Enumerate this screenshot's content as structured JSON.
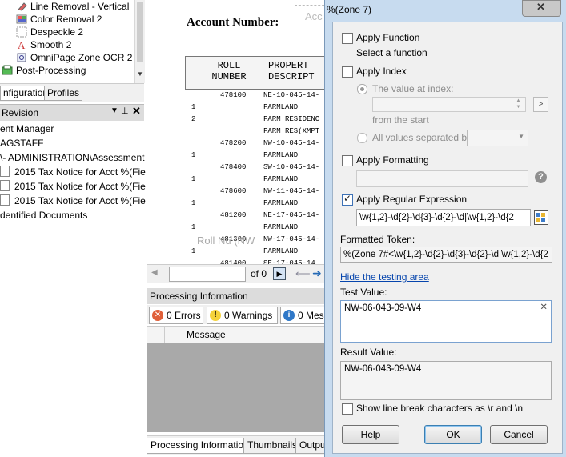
{
  "left_tree": {
    "items": [
      {
        "label": "Line Removal - Vertical",
        "icon": "eraser-icon"
      },
      {
        "label": "Color Removal 2",
        "icon": "color-palette-icon"
      },
      {
        "label": "Despeckle 2",
        "icon": "despeckle-icon"
      },
      {
        "label": "Smooth 2",
        "icon": "smooth-a-icon"
      },
      {
        "label": "OmniPage Zone OCR 2",
        "icon": "ocr-icon"
      },
      {
        "label": "Post-Processing",
        "icon": "post-processing-icon"
      }
    ],
    "tabs": {
      "configuration": "nfiguration",
      "profiles": "Profiles"
    }
  },
  "revision_panel": {
    "title": "Revision",
    "lines": [
      "ent Manager",
      "AGSTAFF",
      "\\- ADMINISTRATION\\Assessment",
      "2015 Tax Notice for Acct %(Fie",
      "2015 Tax Notice for Acct %(Fie",
      "2015 Tax Notice for Acct %(Fie",
      "dentified Documents"
    ]
  },
  "document": {
    "account_label": "Account Number:",
    "account_placeholder": "Acc",
    "col_roll": "ROLL NUMBER",
    "col_prop": "PROPERT DESCRIPT",
    "rows": [
      {
        "n": "",
        "roll": "478100",
        "desc": "NE-10-045-14-"
      },
      {
        "n": "1",
        "roll": "",
        "desc": "FARMLAND"
      },
      {
        "n": "2",
        "roll": "",
        "desc": "FARM RESIDENC"
      },
      {
        "n": "",
        "roll": "",
        "desc": "FARM RES(XMPT"
      },
      {
        "n": "",
        "roll": "478200",
        "desc": "NW-10-045-14-"
      },
      {
        "n": "1",
        "roll": "",
        "desc": "FARMLAND"
      },
      {
        "n": "",
        "roll": "478400",
        "desc": "SW-10-045-14-"
      },
      {
        "n": "1",
        "roll": "",
        "desc": "FARMLAND"
      },
      {
        "n": "",
        "roll": "478600",
        "desc": "NW-11-045-14-"
      },
      {
        "n": "1",
        "roll": "",
        "desc": "FARMLAND"
      },
      {
        "n": "",
        "roll": "481200",
        "desc": "NE-17-045-14-"
      },
      {
        "n": "1",
        "roll": "",
        "desc": "FARMLAND"
      },
      {
        "n": "",
        "roll": "481300",
        "desc": "NW-17-045-14-"
      },
      {
        "n": "1",
        "roll": "",
        "desc": "FARMLAND"
      },
      {
        "n": "",
        "roll": "481400",
        "desc": "SE-17-045-14"
      }
    ],
    "overlay_label": "Roll Nu   (NW",
    "page_of": "of 0"
  },
  "processing": {
    "title": "Processing Information",
    "errors": "0 Errors",
    "warnings": "0 Warnings",
    "messages": "0 Mes",
    "col_message": "Message",
    "bottom_tabs": [
      "Processing Information",
      "Thumbnails",
      "Outpu"
    ]
  },
  "dialog": {
    "title": "%(Zone 7)",
    "apply_function": {
      "label": "Apply Function",
      "sub": "Select a function"
    },
    "apply_index": {
      "label": "Apply Index",
      "value_at_index": "The value at index:",
      "from_start": "from the  start",
      "all_values": "All values separated by:"
    },
    "apply_formatting": {
      "label": "Apply Formatting"
    },
    "apply_regex": {
      "label": "Apply Regular Expression",
      "value": "\\w{1,2}-\\d{2}-\\d{3}-\\d{2}-\\d|\\w{1,2}-\\d{2"
    },
    "formatted_token_label": "Formatted Token:",
    "formatted_token_value": "%(Zone 7#<\\w{1,2}-\\d{2}-\\d{3}-\\d{2}-\\d|\\w{1,2}-\\d{2",
    "hide_testing_link": "Hide the testing area",
    "test_value_label": "Test Value:",
    "test_value": "NW-06-043-09-W4",
    "result_value_label": "Result Value:",
    "result_value": "NW-06-043-09-W4",
    "show_linebreak": "Show line break characters as \\r and \\n",
    "buttons": {
      "help": "Help",
      "ok": "OK",
      "cancel": "Cancel"
    },
    "checked": {
      "apply_regex": true,
      "apply_function": false,
      "apply_index": false,
      "apply_formatting": false,
      "show_linebreak": false
    },
    "colors": {
      "link": "#0645ad",
      "ok_border": "#3c7fb1"
    }
  }
}
